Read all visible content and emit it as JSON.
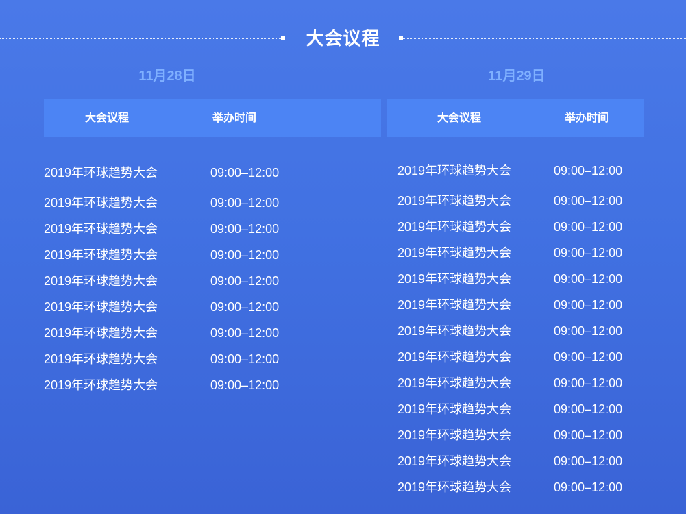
{
  "page": {
    "title": "大会议程"
  },
  "days": [
    {
      "date": "11月28日",
      "headers": {
        "name": "大会议程",
        "time": "举办时间"
      },
      "rows": [
        {
          "name": "2019年环球趋势大会",
          "time": "09:00–12:00"
        },
        {
          "name": "2019年环球趋势大会",
          "time": "09:00–12:00"
        },
        {
          "name": "2019年环球趋势大会",
          "time": "09:00–12:00"
        },
        {
          "name": "2019年环球趋势大会",
          "time": "09:00–12:00"
        },
        {
          "name": "2019年环球趋势大会",
          "time": "09:00–12:00"
        },
        {
          "name": "2019年环球趋势大会",
          "time": "09:00–12:00"
        },
        {
          "name": "2019年环球趋势大会",
          "time": "09:00–12:00"
        },
        {
          "name": "2019年环球趋势大会",
          "time": "09:00–12:00"
        },
        {
          "name": "2019年环球趋势大会",
          "time": "09:00–12:00"
        }
      ]
    },
    {
      "date": "11月29日",
      "headers": {
        "name": "大会议程",
        "time": "举办时间"
      },
      "rows": [
        {
          "name": "2019年环球趋势大会",
          "time": "09:00–12:00"
        },
        {
          "name": "2019年环球趋势大会",
          "time": "09:00–12:00"
        },
        {
          "name": "2019年环球趋势大会",
          "time": "09:00–12:00"
        },
        {
          "name": "2019年环球趋势大会",
          "time": "09:00–12:00"
        },
        {
          "name": "2019年环球趋势大会",
          "time": "09:00–12:00"
        },
        {
          "name": "2019年环球趋势大会",
          "time": "09:00–12:00"
        },
        {
          "name": "2019年环球趋势大会",
          "time": "09:00–12:00"
        },
        {
          "name": "2019年环球趋势大会",
          "time": "09:00–12:00"
        },
        {
          "name": "2019年环球趋势大会",
          "time": "09:00–12:00"
        },
        {
          "name": "2019年环球趋势大会",
          "time": "09:00–12:00"
        },
        {
          "name": "2019年环球趋势大会",
          "time": "09:00–12:00"
        },
        {
          "name": "2019年环球趋势大会",
          "time": "09:00–12:00"
        },
        {
          "name": "2019年环球趋势大会",
          "time": "09:00–12:00"
        }
      ]
    }
  ],
  "colors": {
    "background": "#4171e2",
    "header_bar": "#4c84f4",
    "date_text": "#7fb0ff",
    "text": "#ffffff"
  }
}
